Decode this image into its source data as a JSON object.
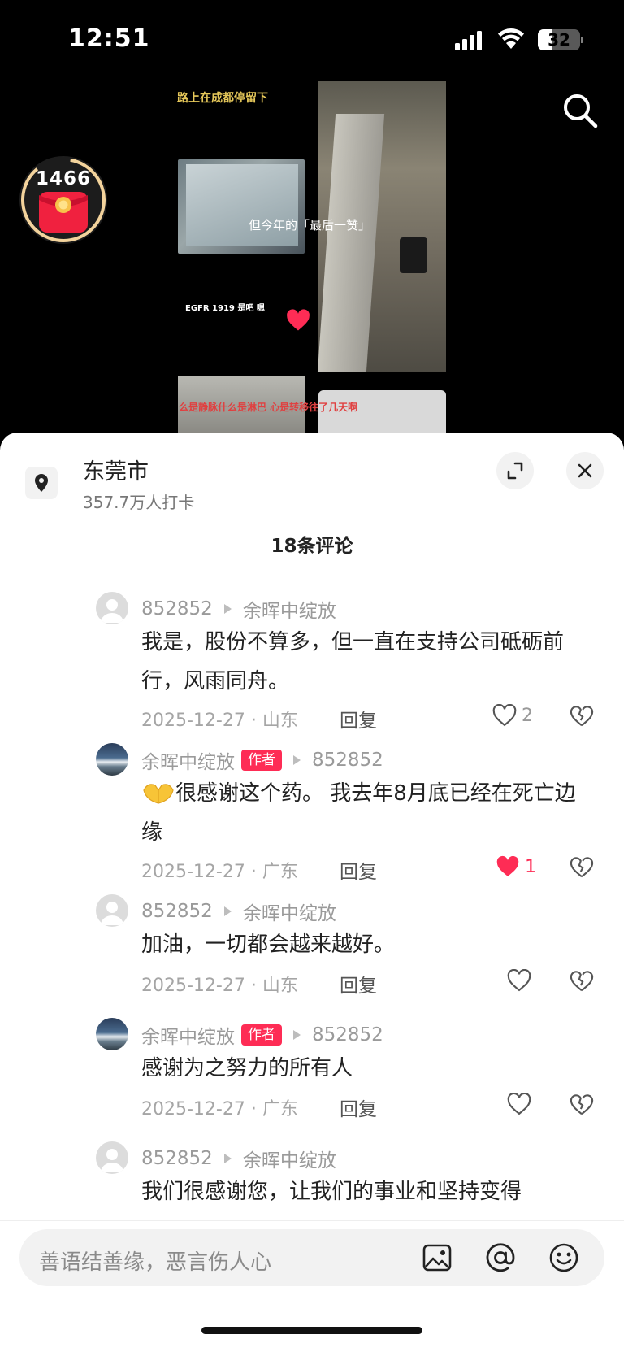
{
  "status_bar": {
    "time": "12:51",
    "battery": "32",
    "battery_level": 0.32
  },
  "video": {
    "caption_top": "路上在成都停留下",
    "caption_mid": "但今年的「最后一赞」",
    "caption_small": "EGFR 1919 是吧 嗯",
    "caption_red": "么是静脉什么是淋巴 心是转移往了几天啊",
    "redpacket_count": "1466"
  },
  "location": {
    "name": "东莞市",
    "checkins": "357.7万人打卡"
  },
  "comments_header": "18条评论",
  "comments": [
    {
      "user": "852852",
      "reply_to": "余晖中绽放",
      "is_author": false,
      "avatar": "gray",
      "text": "我是，股份不算多，但一直在支持公司砥砺前行，风雨同舟。",
      "date_loc": "2025-12-27 · 山东",
      "reply": "回复",
      "likes": "2",
      "liked": false
    },
    {
      "user": "余晖中绽放",
      "badge": "作者",
      "reply_to": "852852",
      "is_author": true,
      "avatar": "photo",
      "text": "很感谢这个药。 我去年8月底已经在死亡边缘",
      "date_loc": "2025-12-27 · 广东",
      "reply": "回复",
      "likes": "1",
      "liked": true
    },
    {
      "user": "852852",
      "reply_to": "余晖中绽放",
      "is_author": false,
      "avatar": "gray",
      "text": "加油，一切都会越来越好。",
      "date_loc": "2025-12-27 · 山东",
      "reply": "回复",
      "likes": "",
      "liked": false
    },
    {
      "user": "余晖中绽放",
      "badge": "作者",
      "reply_to": "852852",
      "is_author": true,
      "avatar": "photo",
      "text": "感谢为之努力的所有人",
      "date_loc": "2025-12-27 · 广东",
      "reply": "回复",
      "likes": "",
      "liked": false
    },
    {
      "user": "852852",
      "reply_to": "余晖中绽放",
      "is_author": false,
      "avatar": "gray",
      "text": "我们很感谢您，让我们的事业和坚持变得",
      "date_loc": "",
      "reply": "",
      "likes": "",
      "liked": false
    }
  ],
  "input": {
    "placeholder": "善语结善缘，恶言伤人心"
  },
  "colors": {
    "accent": "#fe2c55",
    "sheet_bg": "#ffffff",
    "meta_gray": "#9a9a9a"
  },
  "icons": [
    "signal-icon",
    "wifi-icon",
    "battery-icon",
    "search-icon",
    "red-packet-icon",
    "location-pin-icon",
    "expand-icon",
    "close-icon",
    "heart-icon",
    "dislike-icon",
    "image-icon",
    "at-icon",
    "emoji-icon",
    "praying-hands-emoji"
  ]
}
